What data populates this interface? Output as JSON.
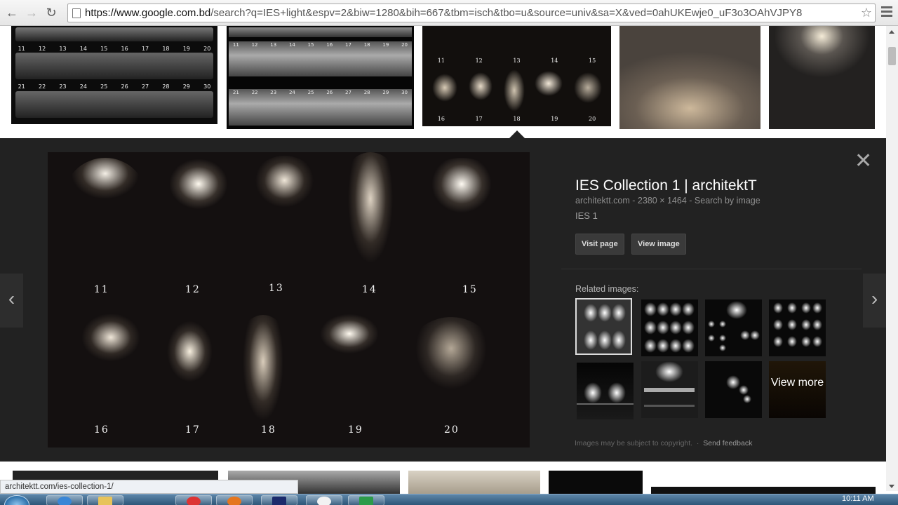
{
  "browser": {
    "url_host": "https://www.google.com.bd",
    "url_path": "/search?q=IES+light&espv=2&biw=1280&bih=667&tbm=isch&tbo=u&source=univ&sa=X&ved=0ahUKEwje0_uF3o3OAhVJPY8",
    "back_icon": "←",
    "forward_icon": "→",
    "reload_icon": "↻",
    "star_icon": "☆"
  },
  "top_grid": {
    "thumb1_row1": [
      "11",
      "12",
      "13",
      "14",
      "15",
      "16",
      "17",
      "18",
      "19",
      "20"
    ],
    "thumb1_row2": [
      "21",
      "22",
      "23",
      "24",
      "25",
      "26",
      "27",
      "28",
      "29",
      "30"
    ],
    "thumb2_row1": [
      "11",
      "12",
      "13",
      "14",
      "15",
      "16",
      "17",
      "18",
      "19",
      "20"
    ],
    "thumb2_row2": [
      "21",
      "22",
      "23",
      "24",
      "25",
      "26",
      "27",
      "28",
      "29",
      "30"
    ],
    "thumb3_row1": [
      "11",
      "12",
      "13",
      "14",
      "15"
    ],
    "thumb3_row2": [
      "16",
      "17",
      "18",
      "19",
      "20"
    ]
  },
  "preview": {
    "image_labels_row1": [
      "11",
      "12",
      "13",
      "14",
      "15"
    ],
    "image_labels_row2": [
      "16",
      "17",
      "18",
      "19",
      "20"
    ],
    "title": "IES Collection 1 | architektT",
    "domain": "architektt.com",
    "dimensions": "2380 × 1464",
    "search_by_image": "Search by image",
    "description": "IES 1",
    "visit_page": "Visit page",
    "view_image": "View image",
    "related_title": "Related images:",
    "view_more": "View more",
    "footer_note": "Images may be subject to copyright.",
    "send_feedback": "Send feedback",
    "close_icon": "✕",
    "prev_icon": "‹",
    "next_icon": "›"
  },
  "status_bar": {
    "link": "architektt.com/ies-collection-1/"
  },
  "taskbar": {
    "clock": "10:11 AM"
  },
  "colors": {
    "panel_bg": "#222222",
    "title_color": "#ffffff",
    "meta_color": "#8f8f8f"
  }
}
